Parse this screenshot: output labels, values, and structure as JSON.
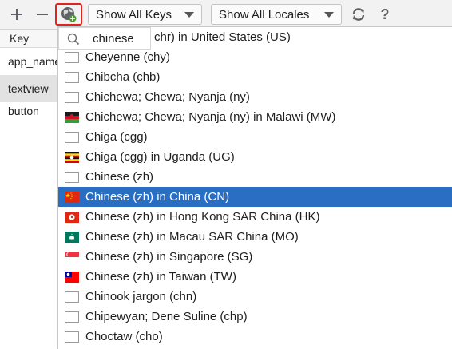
{
  "toolbar": {
    "add_icon": "plus-icon",
    "remove_icon": "minus-icon",
    "locale_icon": "globe-add-icon",
    "show_keys_label": "Show All Keys",
    "show_locales_label": "Show All Locales",
    "refresh_icon": "refresh-icon",
    "help_label": "?",
    "highlight_color": "#e0241d"
  },
  "table": {
    "key_header": "Key",
    "rows": [
      {
        "key": "app_name",
        "selected": false
      },
      {
        "key": "textview",
        "selected": true
      },
      {
        "key": "button",
        "selected": false
      }
    ]
  },
  "popup": {
    "search_value": "chinese",
    "search_icon": "search-icon",
    "selection_color": "#2a6ec3",
    "items": [
      {
        "label": "chr) in United States (US)",
        "flag": "none",
        "selected": false
      },
      {
        "label": "Cheyenne (chy)",
        "flag": "blank",
        "selected": false
      },
      {
        "label": "Chibcha (chb)",
        "flag": "blank",
        "selected": false
      },
      {
        "label": "Chichewa; Chewa; Nyanja (ny)",
        "flag": "blank",
        "selected": false
      },
      {
        "label": "Chichewa; Chewa; Nyanja (ny) in Malawi (MW)",
        "flag": "MW",
        "selected": false
      },
      {
        "label": "Chiga (cgg)",
        "flag": "blank",
        "selected": false
      },
      {
        "label": "Chiga (cgg) in Uganda (UG)",
        "flag": "UG",
        "selected": false
      },
      {
        "label": "Chinese (zh)",
        "flag": "blank",
        "selected": false
      },
      {
        "label": "Chinese (zh) in China (CN)",
        "flag": "CN",
        "selected": true
      },
      {
        "label": "Chinese (zh) in Hong Kong SAR China (HK)",
        "flag": "HK",
        "selected": false
      },
      {
        "label": "Chinese (zh) in Macau SAR China (MO)",
        "flag": "MO",
        "selected": false
      },
      {
        "label": "Chinese (zh) in Singapore (SG)",
        "flag": "SG",
        "selected": false
      },
      {
        "label": "Chinese (zh) in Taiwan (TW)",
        "flag": "TW",
        "selected": false
      },
      {
        "label": "Chinook jargon (chn)",
        "flag": "blank",
        "selected": false
      },
      {
        "label": "Chipewyan; Dene Suline (chp)",
        "flag": "blank",
        "selected": false
      },
      {
        "label": "Choctaw (cho)",
        "flag": "blank",
        "selected": false
      }
    ]
  }
}
